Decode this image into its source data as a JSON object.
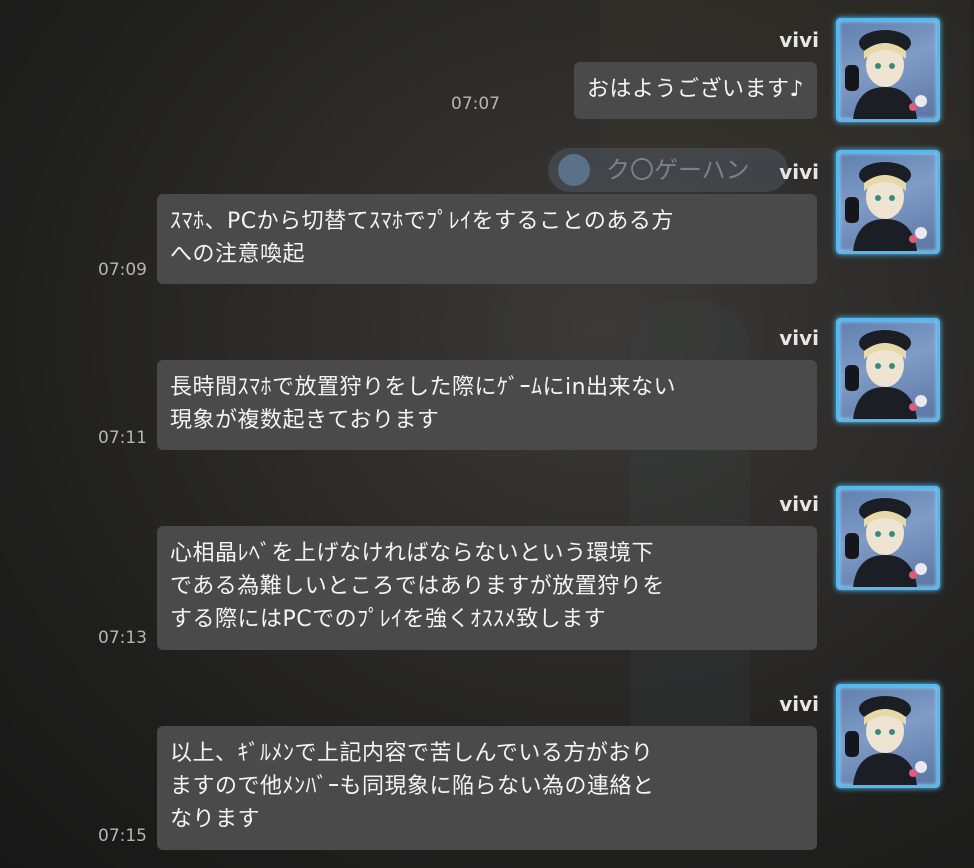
{
  "chat": {
    "messages": [
      {
        "sender": "vivi",
        "time": "07:07",
        "text": "おはようございます♪"
      },
      {
        "sender": "vivi",
        "time": "07:09",
        "text": "ｽﾏﾎ、PCから切替てｽﾏﾎでﾌﾟﾚｲをすることのある方\nへの注意喚起"
      },
      {
        "sender": "vivi",
        "time": "07:11",
        "text": "長時間ｽﾏﾎで放置狩りをした際にｹﾞｰﾑにin出来ない\n現象が複数起きております"
      },
      {
        "sender": "vivi",
        "time": "07:13",
        "text": "心相晶ﾚﾍﾞを上げなければならないという環境下\nである為難しいところではありますが放置狩りを\nする際にはPCでのﾌﾟﾚｲを強くｵｽｽﾒ致します"
      },
      {
        "sender": "vivi",
        "time": "07:15",
        "text": "以上、ｷﾞﾙﾒﾝで上記内容で苦しんでいる方がおり\nますので他ﾒﾝﾊﾞｰも同現象に陥らない為の連絡と\nなります"
      }
    ]
  },
  "background": {
    "banner_text": "ク〇ゲーハン"
  },
  "icons": {
    "avatar": "character-portrait-icon"
  },
  "colors": {
    "bubble": "#4a4a4a",
    "avatar_frame": "#55b9f0"
  }
}
